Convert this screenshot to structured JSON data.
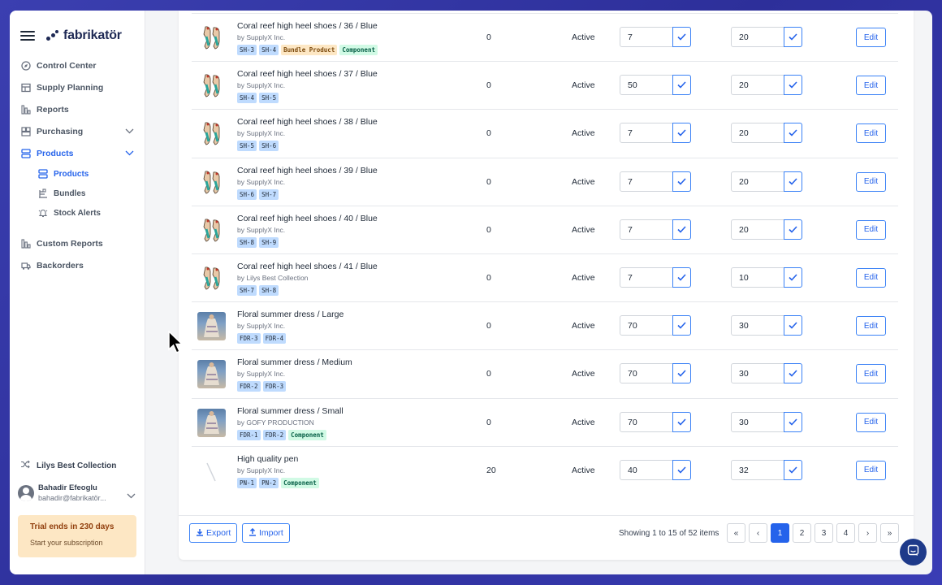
{
  "app": {
    "name": "fabrikatör"
  },
  "sidebar": {
    "items": [
      {
        "label": "Control Center",
        "icon": "compass-icon"
      },
      {
        "label": "Supply Planning",
        "icon": "table-icon"
      },
      {
        "label": "Reports",
        "icon": "bar-chart-icon"
      },
      {
        "label": "Purchasing",
        "icon": "box-icon"
      },
      {
        "label": "Products",
        "icon": "layers-icon"
      }
    ],
    "sub_items": [
      {
        "label": "Products",
        "icon": "layers-icon"
      },
      {
        "label": "Bundles",
        "icon": "bundle-icon"
      },
      {
        "label": "Stock Alerts",
        "icon": "bell-icon"
      }
    ],
    "bottom_items": [
      {
        "label": "Custom Reports",
        "icon": "bar-chart-icon"
      },
      {
        "label": "Backorders",
        "icon": "truck-icon"
      }
    ],
    "org": "Lilys Best Collection",
    "user": {
      "name": "Bahadir Efeoglu",
      "email": "bahadir@fabrikatör..."
    },
    "trial": {
      "title": "Trial ends in 230 days",
      "cta": "Start your subscription"
    }
  },
  "table": {
    "rows": [
      {
        "name": "Coral reef high heel shoes / 36 / Blue",
        "vendor": "by SupplyX Inc.",
        "tags": [
          "SH-3",
          "SH-4",
          "Bundle Product",
          "Component"
        ],
        "qty": "0",
        "status": "Active",
        "val1": "7",
        "val2": "20",
        "edit": "Edit"
      },
      {
        "name": "Coral reef high heel shoes / 37 / Blue",
        "vendor": "by SupplyX Inc.",
        "tags": [
          "SH-4",
          "SH-5"
        ],
        "qty": "0",
        "status": "Active",
        "val1": "50",
        "val2": "20",
        "edit": "Edit"
      },
      {
        "name": "Coral reef high heel shoes / 38 / Blue",
        "vendor": "by SupplyX Inc.",
        "tags": [
          "SH-5",
          "SH-6"
        ],
        "qty": "0",
        "status": "Active",
        "val1": "7",
        "val2": "20",
        "edit": "Edit"
      },
      {
        "name": "Coral reef high heel shoes / 39 / Blue",
        "vendor": "by SupplyX Inc.",
        "tags": [
          "SH-6",
          "SH-7"
        ],
        "qty": "0",
        "status": "Active",
        "val1": "7",
        "val2": "20",
        "edit": "Edit"
      },
      {
        "name": "Coral reef high heel shoes / 40 / Blue",
        "vendor": "by SupplyX Inc.",
        "tags": [
          "SH-8",
          "SH-9"
        ],
        "qty": "0",
        "status": "Active",
        "val1": "7",
        "val2": "20",
        "edit": "Edit"
      },
      {
        "name": "Coral reef high heel shoes / 41 / Blue",
        "vendor": "by Lilys Best Collection",
        "tags": [
          "SH-7",
          "SH-8"
        ],
        "qty": "0",
        "status": "Active",
        "val1": "7",
        "val2": "10",
        "edit": "Edit"
      },
      {
        "name": "Floral summer dress / Large",
        "vendor": "by SupplyX Inc.",
        "tags": [
          "FDR-3",
          "FDR-4"
        ],
        "qty": "0",
        "status": "Active",
        "val1": "70",
        "val2": "30",
        "edit": "Edit"
      },
      {
        "name": "Floral summer dress / Medium",
        "vendor": "by SupplyX Inc.",
        "tags": [
          "FDR-2",
          "FDR-3"
        ],
        "qty": "0",
        "status": "Active",
        "val1": "70",
        "val2": "30",
        "edit": "Edit"
      },
      {
        "name": "Floral summer dress / Small",
        "vendor": "by GOFY PRODUCTION",
        "tags": [
          "FDR-1",
          "FDR-2",
          "Component"
        ],
        "qty": "0",
        "status": "Active",
        "val1": "70",
        "val2": "30",
        "edit": "Edit"
      },
      {
        "name": "High quality pen",
        "vendor": "by SupplyX Inc.",
        "tags": [
          "PN-1",
          "PN-2",
          "Component"
        ],
        "qty": "20",
        "status": "Active",
        "val1": "40",
        "val2": "32",
        "edit": "Edit"
      }
    ]
  },
  "footer": {
    "export_label": "Export",
    "import_label": "Import",
    "showing": "Showing 1 to 15 of 52 items",
    "pages": [
      "«",
      "‹",
      "1",
      "2",
      "3",
      "4",
      "›",
      "»"
    ],
    "current_page": "1"
  },
  "colors": {
    "accent": "#2563eb",
    "trial_bg": "#fde7c4",
    "component_tag": "#d1fae5",
    "bundle_tag": "#fde7c4"
  }
}
